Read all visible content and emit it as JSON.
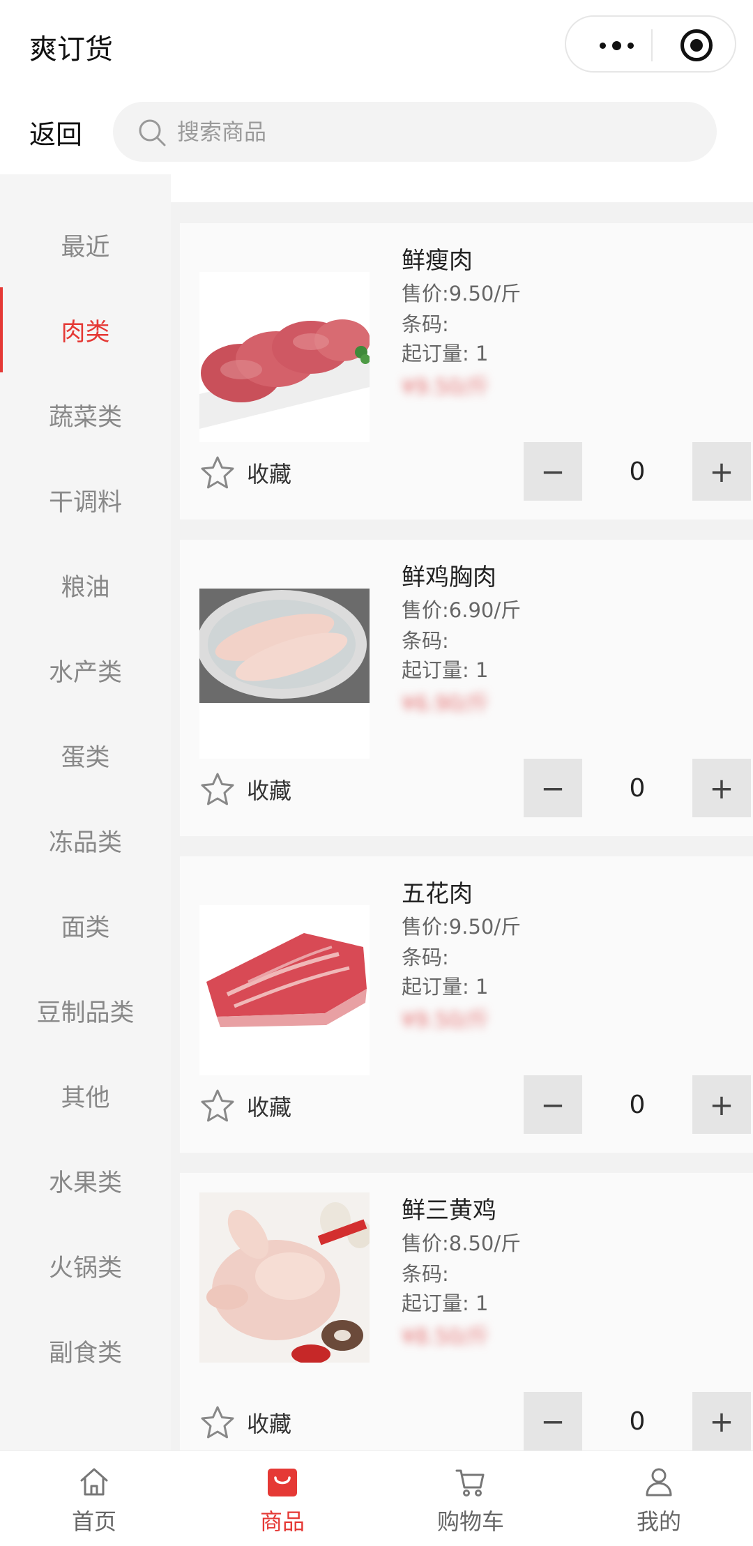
{
  "app": {
    "title": "爽订货"
  },
  "capsule": {
    "more_icon": "more-dots-icon",
    "close_icon": "target-icon"
  },
  "search": {
    "back_label": "返回",
    "placeholder": "搜索商品",
    "value": ""
  },
  "categories": [
    {
      "label": "最近"
    },
    {
      "label": "肉类",
      "active": true
    },
    {
      "label": "蔬菜类"
    },
    {
      "label": "干调料"
    },
    {
      "label": "粮油"
    },
    {
      "label": "水产类"
    },
    {
      "label": "蛋类"
    },
    {
      "label": "冻品类"
    },
    {
      "label": "面类"
    },
    {
      "label": "豆制品类"
    },
    {
      "label": "其他"
    },
    {
      "label": "水果类"
    },
    {
      "label": "火锅类"
    },
    {
      "label": "副食类"
    }
  ],
  "products": [
    {
      "name": "鲜瘦肉",
      "price": "售价:9.50/斤",
      "barcode": "条码:",
      "moq": "起订量:  1",
      "hidden_price": "¥9.50/斤",
      "fav_label": "收藏",
      "qty": "0",
      "image": "pork-slices"
    },
    {
      "name": "鲜鸡胸肉",
      "price": "售价:6.90/斤",
      "barcode": "条码:",
      "moq": "起订量:  1",
      "hidden_price": "¥6.90/斤",
      "fav_label": "收藏",
      "qty": "0",
      "image": "chicken-breast"
    },
    {
      "name": "五花肉",
      "price": "售价:9.50/斤",
      "barcode": "条码:",
      "moq": "起订量:  1",
      "hidden_price": "¥9.50/斤",
      "fav_label": "收藏",
      "qty": "0",
      "image": "pork-belly"
    },
    {
      "name": "鲜三黄鸡",
      "price": "售价:8.50/斤",
      "barcode": "条码:",
      "moq": "起订量:  1",
      "hidden_price": "¥8.50/斤",
      "fav_label": "收藏",
      "qty": "0",
      "image": "whole-chicken"
    }
  ],
  "tabs": [
    {
      "label": "首页",
      "icon": "home-icon"
    },
    {
      "label": "商品",
      "icon": "shop-bag-icon",
      "active": true
    },
    {
      "label": "购物车",
      "icon": "cart-icon"
    },
    {
      "label": "我的",
      "icon": "user-icon"
    }
  ],
  "colors": {
    "accent": "#e53935",
    "muted": "#888888",
    "sidebar_bg": "#f5f5f5"
  }
}
